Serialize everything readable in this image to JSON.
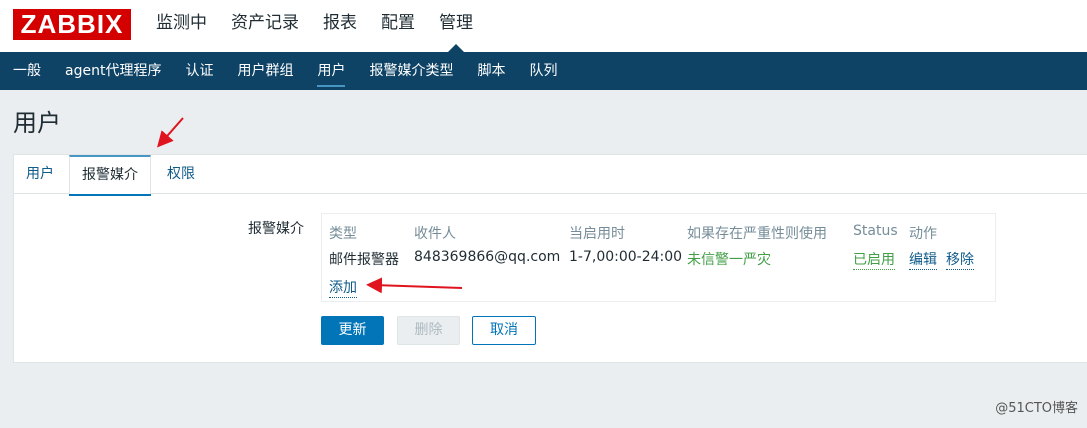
{
  "logo": "ZABBIX",
  "top_nav": [
    "监测中",
    "资产记录",
    "报表",
    "配置",
    "管理"
  ],
  "sub_nav": [
    "一般",
    "agent代理程序",
    "认证",
    "用户群组",
    "用户",
    "报警媒介类型",
    "脚本",
    "队列"
  ],
  "page_title": "用户",
  "tabs": [
    "用户",
    "报警媒介",
    "权限"
  ],
  "media": {
    "label": "报警媒介",
    "columns": [
      "类型",
      "收件人",
      "当启用时",
      "如果存在严重性则使用",
      "Status",
      "动作"
    ],
    "row": {
      "type": "邮件报警器",
      "recipient": "848369866@qq.com",
      "when_active": "1-7,00:00-24:00",
      "severity": "未信警一严灾",
      "status": "已启用",
      "edit": "编辑",
      "remove": "移除"
    },
    "add": "添加"
  },
  "buttons": {
    "update": "更新",
    "delete": "删除",
    "cancel": "取消"
  },
  "watermark": "@51CTO博客",
  "colors": {
    "logo_red": "#d40000",
    "subnav_bg": "#0e4366",
    "primary": "#0275b8",
    "green": "#429e47",
    "annotation_arrow": "#e0141e"
  }
}
